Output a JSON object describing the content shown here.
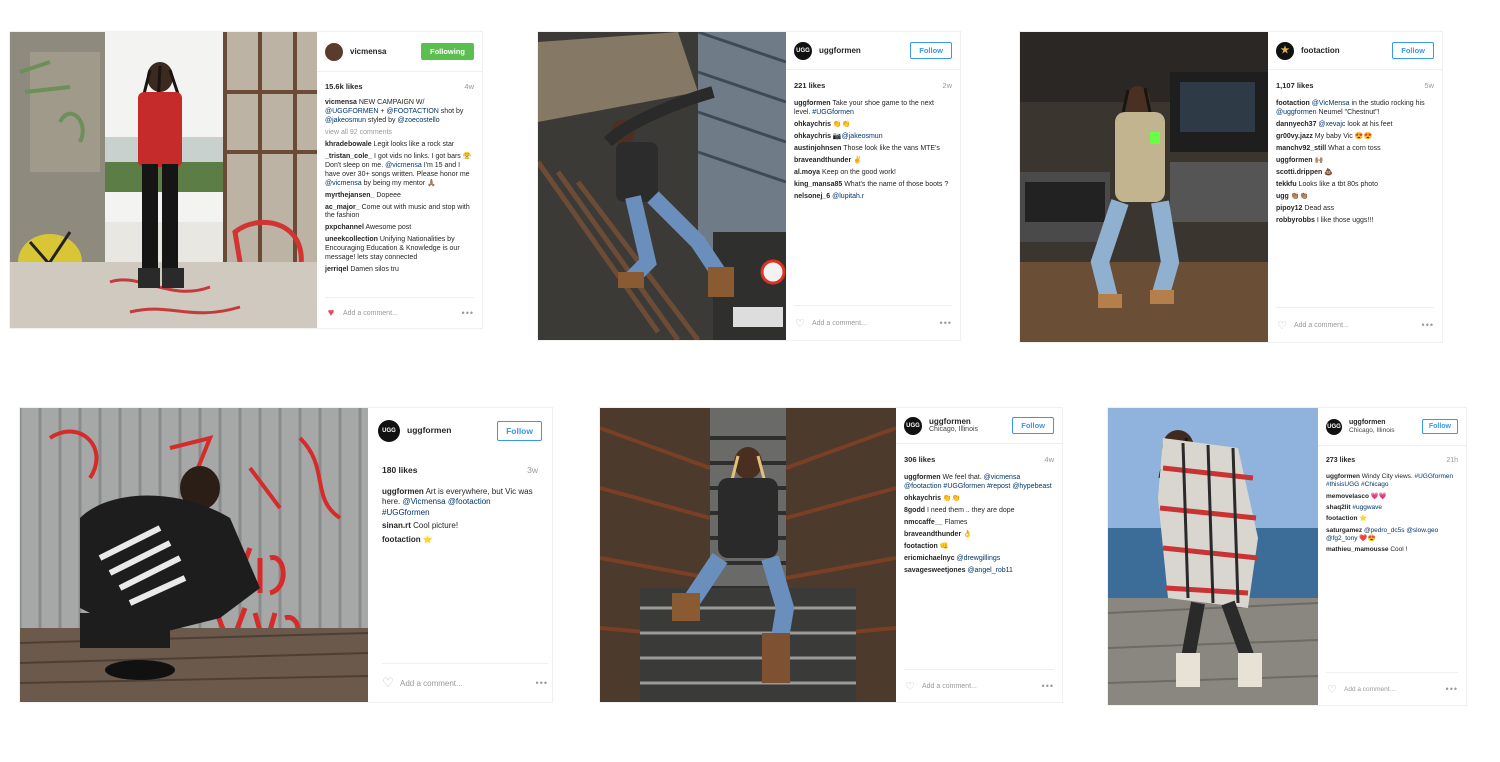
{
  "posts": [
    {
      "user": "vicmensa",
      "avatar_text": "",
      "location": "",
      "button": "Following",
      "likes": "15.6k likes",
      "age": "4w",
      "view_all": "view all 92 comments",
      "caption_user": "vicmensa",
      "caption": "NEW CAMPAIGN W/ @UGGFORMEN + @FOOTACTION shot by @jakeosmun styled by @zoecostello",
      "comments": [
        {
          "user": "khradebowale",
          "text": "Legit looks like a rock star"
        },
        {
          "user": "_tristan_cole_",
          "text": "I got vids no links. I got bars 😤 Don't sleep on me. @vicmensa I'm 15 and I have over 30+ songs written. Please honor me @vicmensa by being my mentor 🙏🏽"
        },
        {
          "user": "myrthejansen_",
          "text": "Dopeee"
        },
        {
          "user": "ac_major_",
          "text": "Come out with music and stop with the fashion"
        },
        {
          "user": "pxpchannel",
          "text": "Awesome post"
        },
        {
          "user": "uneekcollection",
          "text": "Unifying Nationalities by Encouraging Education & Knowledge is our message! lets stay connected"
        },
        {
          "user": "jerriqel",
          "text": "Damen silos tru"
        }
      ],
      "add_comment": "Add a comment...",
      "liked": true
    },
    {
      "user": "uggformen",
      "avatar_text": "UGG",
      "location": "",
      "button": "Follow",
      "likes": "221 likes",
      "age": "2w",
      "view_all": "",
      "caption_user": "uggformen",
      "caption": "Take your shoe game to the next level. #UGGformen",
      "comments": [
        {
          "user": "ohkaychris",
          "text": "👏👏"
        },
        {
          "user": "ohkaychris",
          "text": "📷@jakeosmun"
        },
        {
          "user": "austinjohnsen",
          "text": "Those look like the vans MTE's"
        },
        {
          "user": "braveandthunder",
          "text": "✌️"
        },
        {
          "user": "al.moya",
          "text": "Keep on the good work!"
        },
        {
          "user": "king_mansa85",
          "text": "What's the name of those boots ?"
        },
        {
          "user": "nelsonej_6",
          "text": "@lupitah.r"
        }
      ],
      "add_comment": "Add a comment...",
      "liked": false
    },
    {
      "user": "footaction",
      "avatar_text": "★",
      "location": "",
      "button": "Follow",
      "likes": "1,107 likes",
      "age": "5w",
      "view_all": "",
      "caption_user": "footaction",
      "caption": "@VicMensa in the studio rocking his @uggformen Neumel \"Chestnut\"!",
      "comments": [
        {
          "user": "dannyech37",
          "text": "@xevajc look at his feet"
        },
        {
          "user": "gr00vy.jazz",
          "text": "My baby Vic 😍😍"
        },
        {
          "user": "manchv92_still",
          "text": "What a corn toss"
        },
        {
          "user": "uggformen",
          "text": "🙌🏽"
        },
        {
          "user": "scotti.drippen",
          "text": "💩"
        },
        {
          "user": "tekkfu",
          "text": "Looks like a tbt 80s photo"
        },
        {
          "user": "ugg",
          "text": "👏🏽👏🏽"
        },
        {
          "user": "pipoy12",
          "text": "Dead ass"
        },
        {
          "user": "robbyrobbs",
          "text": "I like those uggs!!!"
        }
      ],
      "add_comment": "Add a comment...",
      "liked": false
    },
    {
      "user": "uggformen",
      "avatar_text": "UGG",
      "location": "",
      "button": "Follow",
      "likes": "180 likes",
      "age": "3w",
      "view_all": "",
      "caption_user": "uggformen",
      "caption": "Art is everywhere, but Vic was here. @Vicmensa @footaction #UGGformen",
      "comments": [
        {
          "user": "sinan.rt",
          "text": "Cool picture!"
        },
        {
          "user": "footaction",
          "text": "⭐️"
        }
      ],
      "add_comment": "Add a comment...",
      "liked": false
    },
    {
      "user": "uggformen",
      "avatar_text": "UGG",
      "location": "Chicago, Illinois",
      "button": "Follow",
      "likes": "306 likes",
      "age": "4w",
      "view_all": "",
      "caption_user": "uggformen",
      "caption": "We feel that. @vicmensa @footaction #UGGformen #repost @hypebeast",
      "comments": [
        {
          "user": "ohkaychris",
          "text": "👏👏"
        },
        {
          "user": "8godd",
          "text": "I need them .. they are dope"
        },
        {
          "user": "nmccaffe__",
          "text": "Flames"
        },
        {
          "user": "braveandthunder",
          "text": "👌"
        },
        {
          "user": "footaction",
          "text": "👊"
        },
        {
          "user": "ericmichaelnyc",
          "text": "@drewgillings"
        },
        {
          "user": "savagesweetjones",
          "text": "@angel_rob11"
        }
      ],
      "add_comment": "Add a comment...",
      "liked": false
    },
    {
      "user": "uggformen",
      "avatar_text": "UGG",
      "location": "Chicago, Illinois",
      "button": "Follow",
      "likes": "273 likes",
      "age": "21h",
      "view_all": "",
      "caption_user": "uggformen",
      "caption": "Windy City views. #UGGformen #thisisUGG #Chicago",
      "comments": [
        {
          "user": "memovelasco",
          "text": "💗💗"
        },
        {
          "user": "shaq2lit",
          "text": "#uggwave"
        },
        {
          "user": "footaction",
          "text": "⭐️"
        },
        {
          "user": "saturgamez",
          "text": "@pedro_dc5s @slow.geo @fg2_tony ❤️😍"
        },
        {
          "user": "mathieu_mamousse",
          "text": "Cool !"
        }
      ],
      "add_comment": "Add a comment...",
      "liked": false
    }
  ],
  "colors": {
    "follow_blue": "#3897f0",
    "following_green": "#5bbf4f",
    "like_red": "#ed4956",
    "link_blue": "#003569"
  },
  "icons": [
    "heart-icon",
    "more-dots-icon"
  ]
}
